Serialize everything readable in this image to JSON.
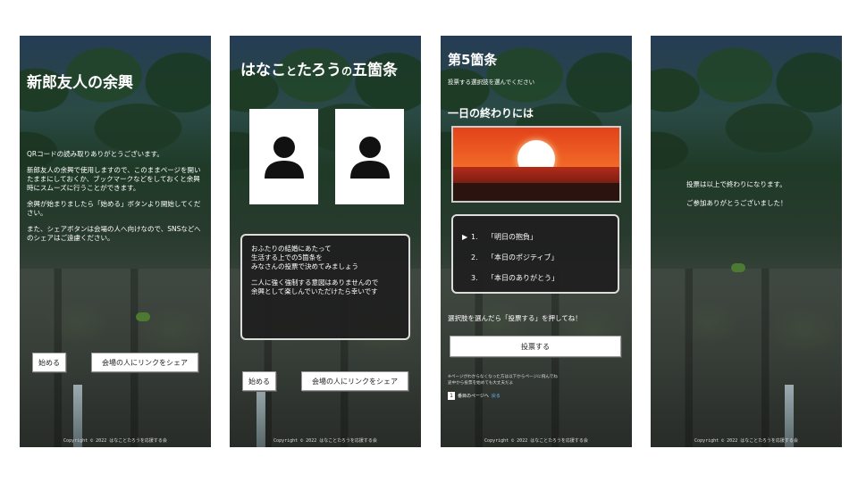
{
  "copyright": "Copyright © 2022 はなことたろうを応援する会",
  "screen1": {
    "title": "新郎友人の余興",
    "paragraphs": [
      "QRコードの読み取りありがとうございます。",
      "新郎友人の余興で使用しますので、このままページを開いたままにしておくか、ブックマークなどをしておくと余興時にスムーズに行うことができます。",
      "余興が始まりましたら「始める」ボタンより開始してください。",
      "また、シェアボタンは会場の人へ向けなので、SNSなどへのシェアはご遠慮ください。"
    ],
    "start_button": "始める",
    "share_button": "会場の人にリンクをシェア"
  },
  "screen2": {
    "title_part1": "はなこ",
    "title_part2": "と",
    "title_part3": "たろう",
    "title_part4": "の",
    "title_part5": "五箇条",
    "dialog_paragraphs": [
      "おふたりの結婚にあたって\n生活する上での5箇条を\nみなさんの投票で決めてみましょう",
      "二人に強く強制する意図はありませんので\n余興として楽しんでいただけたら幸いです"
    ],
    "start_button": "始める",
    "share_button": "会場の人にリンクをシェア"
  },
  "screen3": {
    "title": "第5箇条",
    "subtitle": "投票する選択肢を選んでください",
    "question": "一日の終わりには",
    "options": [
      {
        "num": "1.",
        "label": "「明日の抱負」"
      },
      {
        "num": "2.",
        "label": "「本日のポジティブ」"
      },
      {
        "num": "3.",
        "label": "「本日のありがとう」"
      }
    ],
    "cursor": "▶",
    "hint": "選択肢を選んだら「投票する」を押してね！",
    "vote_button": "投票する",
    "note": "※ページがわからなくなった方は以下からページに飛んでね\n途中から投票を始めても大丈夫だよ",
    "page_box": "1",
    "page_link_prefix": "番目のページへ",
    "page_link": "戻る"
  },
  "screen4": {
    "messages": [
      "投票は以上で終わりになります。",
      "ご参加ありがとうございました！"
    ]
  }
}
